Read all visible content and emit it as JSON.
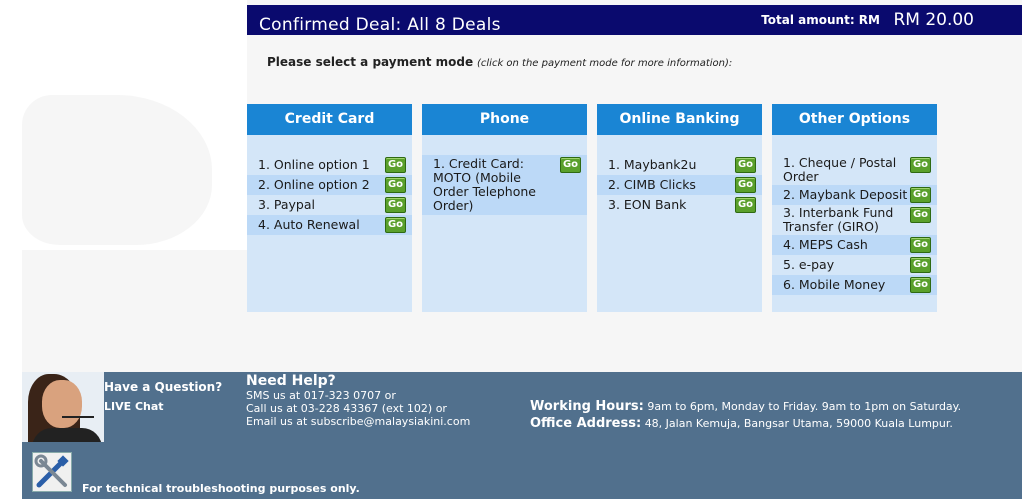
{
  "header": {
    "title": "Confirmed Deal: All 8 Deals",
    "total_label": "Total amount: RM",
    "total_value": "RM 20.00"
  },
  "prompt": {
    "bold": "Please select a payment mode",
    "italic": "(click on the payment mode for more information):"
  },
  "go_label": "Go",
  "columns": [
    {
      "title": "Credit Card",
      "items": [
        "1. Online option 1",
        "2. Online option 2",
        "3. Paypal",
        "4. Auto Renewal"
      ]
    },
    {
      "title": "Phone",
      "items": [
        "1. Credit Card: MOTO (Mobile Order Telephone Order)"
      ]
    },
    {
      "title": "Online Banking",
      "items": [
        "1. Maybank2u",
        "2. CIMB Clicks",
        "3. EON Bank"
      ]
    },
    {
      "title": "Other Options",
      "items": [
        "1. Cheque / Postal Order",
        "2. Maybank Deposit",
        "3. Interbank Fund Transfer (GIRO)",
        "4. MEPS Cash",
        "5. e-pay",
        "6. Mobile Money"
      ]
    }
  ],
  "footer": {
    "question": "Have a Question?",
    "live_chat": "LIVE Chat",
    "help_title": "Need Help?",
    "sms": "SMS us at 017-323 0707 or",
    "call": "Call us at 03-228 43367 (ext 102) or",
    "email": "Email us at subscribe@malaysiakini.com",
    "hours_label": "Working Hours:",
    "hours_value": "9am to 6pm, Monday to Friday. 9am to 1pm on Saturday.",
    "address_label": "Office Address:",
    "address_value": "48, Jalan Kemuja, Bangsar Utama, 59000 Kuala Lumpur.",
    "technical": "For technical troubleshooting purposes only."
  },
  "colors": {
    "header_bg": "#0a0a6e",
    "column_head": "#1a85d4",
    "column_bg": "#d4e6f8",
    "column_alt_row": "#bcd9f7",
    "go_button": "#5aa02c",
    "footer_bg": "#51708d"
  }
}
